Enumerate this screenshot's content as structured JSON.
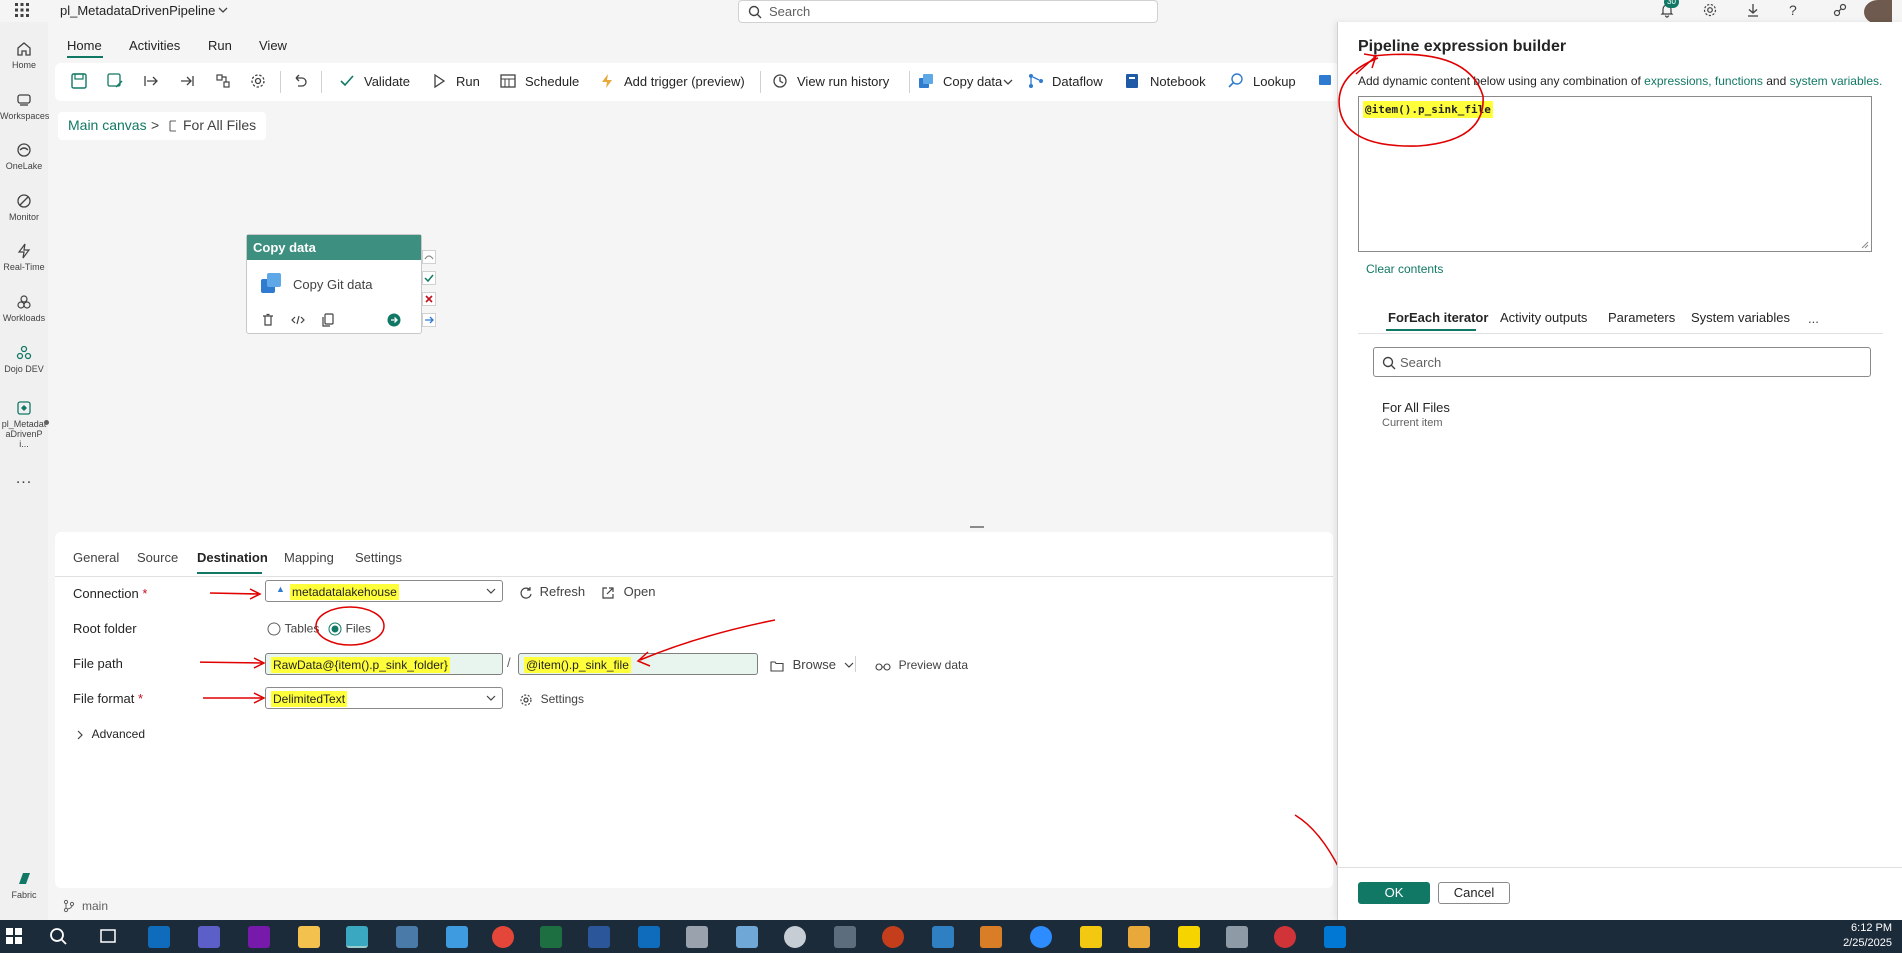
{
  "app": {
    "title": "pl_MetadataDrivenPipeline",
    "search_placeholder": "Search",
    "notification_count": "30"
  },
  "rail": {
    "items": [
      {
        "label": "Home"
      },
      {
        "label": "Workspaces"
      },
      {
        "label": "OneLake"
      },
      {
        "label": "Monitor"
      },
      {
        "label": "Real-Time"
      },
      {
        "label": "Workloads"
      },
      {
        "label": "Dojo DEV"
      },
      {
        "label": "pl_Metadat aDrivenPi..."
      }
    ],
    "more": "...",
    "brand": "Fabric"
  },
  "ribbon": {
    "tabs": [
      "Home",
      "Activities",
      "Run",
      "View"
    ],
    "buttons": {
      "validate": "Validate",
      "run": "Run",
      "schedule": "Schedule",
      "add_trigger": "Add trigger (preview)",
      "view_run_history": "View run history",
      "copy_data": "Copy data",
      "dataflow": "Dataflow",
      "notebook": "Notebook",
      "lookup": "Lookup"
    }
  },
  "breadcrumb": {
    "main": "Main canvas",
    "sep": ">",
    "current": "For All Files"
  },
  "activity": {
    "type": "Copy data",
    "name": "Copy Git data"
  },
  "bottom": {
    "tabs": [
      "General",
      "Source",
      "Destination",
      "Mapping",
      "Settings"
    ],
    "connection": {
      "label": "Connection",
      "value": "metadatalakehouse",
      "refresh": "Refresh",
      "open": "Open"
    },
    "root_folder": {
      "label": "Root folder",
      "option_tables": "Tables",
      "option_files": "Files",
      "selected": "Files"
    },
    "file_path": {
      "label": "File path",
      "folder": "RawData@{item().p_sink_folder}",
      "sep": "/",
      "file": "@item().p_sink_file",
      "browse": "Browse",
      "preview": "Preview data"
    },
    "file_format": {
      "label": "File format",
      "value": "DelimitedText",
      "settings": "Settings"
    },
    "advanced": "Advanced",
    "required_mark": "*"
  },
  "status": {
    "branch": "main"
  },
  "expr": {
    "title": "Pipeline expression builder",
    "desc_prefix": "Add dynamic content below using any combination of ",
    "desc_expressions": "expressions,",
    "desc_functions": "functions",
    "desc_and": " and ",
    "desc_sysvars": "system variables.",
    "value": "@item().p_sink_file",
    "clear": "Clear contents",
    "tabs": [
      "ForEach iterator",
      "Activity outputs",
      "Parameters",
      "System variables"
    ],
    "more": "...",
    "search_placeholder": "Search",
    "iterator_name": "For All Files",
    "iterator_sub": "Current item",
    "ok": "OK",
    "cancel": "Cancel"
  },
  "clock": {
    "time": "6:12 PM",
    "date": "2/25/2025"
  },
  "colors": {
    "accent": "#117865",
    "highlight": "#ffff3a",
    "annotation": "#e00000"
  }
}
